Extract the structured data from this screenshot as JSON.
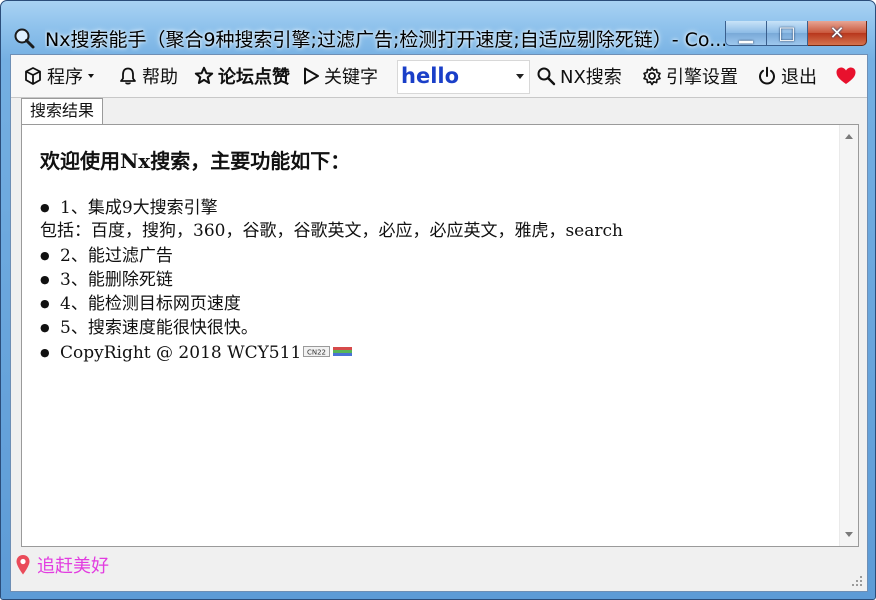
{
  "window": {
    "title": "Nx搜索能手（聚合9种搜索引擎;过滤广告;检测打开速度;自适应剔除死链）- Co...",
    "min_glyph": "▁",
    "max_glyph": "□",
    "close_glyph": "✕"
  },
  "toolbar": {
    "program_label": "程序",
    "help_label": "帮助",
    "forum_label": "论坛点赞",
    "keyword_label": "关键字",
    "query_value": "hello",
    "search_label": "NX搜索",
    "engine_settings_label": "引擎设置",
    "exit_label": "退出"
  },
  "tabs": {
    "results": "搜索结果"
  },
  "content": {
    "heading": "欢迎使用Nx搜索，主要功能如下：",
    "lines": [
      "1、集成9大搜索引擎",
      "包括：百度，搜狗，360，谷歌，谷歌英文，必应，必应英文，雅虎，search",
      "2、能过滤广告",
      "3、能删除死链",
      "4、能检测目标网页速度",
      "5、搜索速度能很快很快。",
      "CopyRight @ 2018 WCY511"
    ],
    "badge_text": "CN22"
  },
  "status": {
    "location_text": "追赶美好"
  },
  "colors": {
    "heart": "#e8112d",
    "status_text": "#e23ce0",
    "query_text": "#1a3fc8"
  }
}
